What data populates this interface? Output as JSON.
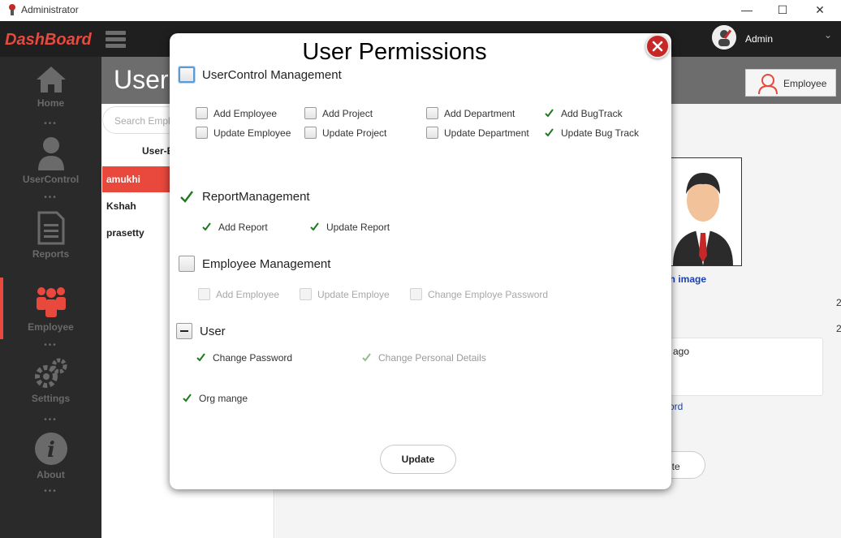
{
  "window": {
    "title": "Administrator",
    "minimize": "—",
    "maximize": "☐",
    "close": "✕"
  },
  "appbar": {
    "brand": "DashBoard",
    "user_name": "Admin",
    "caret": "⌄"
  },
  "sidebar": {
    "items": [
      {
        "label": "Home",
        "icon": "home-icon"
      },
      {
        "label": "UserControl",
        "icon": "user-icon"
      },
      {
        "label": "Reports",
        "icon": "document-icon"
      },
      {
        "label": "Employee",
        "icon": "group-icon",
        "active": true
      },
      {
        "label": "Settings",
        "icon": "gear-icon"
      },
      {
        "label": "About",
        "icon": "info-icon"
      }
    ],
    "dots": "•••"
  },
  "background": {
    "header_title": "User-",
    "employee_button": "Employee",
    "search_placeholder": "Search Empl",
    "column_header": "User-E",
    "users": [
      "amukhi",
      "Kshah",
      "prasetty"
    ],
    "photo_link": "ch image",
    "card_text": "ago",
    "password_link": "vord",
    "delete_button": "ete",
    "edge_marks": [
      "2",
      "2"
    ]
  },
  "modal": {
    "title": "User Permissions",
    "sections": {
      "user_control": {
        "label": "UserControl Management",
        "state": "unchecked-focused",
        "items": [
          {
            "label": "Add Employee",
            "state": "unchecked"
          },
          {
            "label": "Update Employee",
            "state": "unchecked"
          },
          {
            "label": "Add Project",
            "state": "unchecked"
          },
          {
            "label": "Update Project",
            "state": "unchecked"
          },
          {
            "label": "Add Department",
            "state": "unchecked"
          },
          {
            "label": "Update Department",
            "state": "unchecked"
          },
          {
            "label": "Add BugTrack",
            "state": "checked"
          },
          {
            "label": "Update Bug Track",
            "state": "checked"
          }
        ]
      },
      "report": {
        "label": "ReportManagement",
        "state": "checked",
        "items": [
          {
            "label": "Add Report",
            "state": "checked"
          },
          {
            "label": "Update Report",
            "state": "checked"
          }
        ]
      },
      "employee": {
        "label": "Employee Management",
        "state": "unchecked",
        "items": [
          {
            "label": "Add Employee",
            "state": "disabled"
          },
          {
            "label": "Update Employe",
            "state": "disabled"
          },
          {
            "label": "Change Employe Password",
            "state": "disabled"
          }
        ]
      },
      "user": {
        "label": "User",
        "state": "indeterminate",
        "items": [
          {
            "label": "Change Password",
            "state": "checked"
          },
          {
            "label": "Change Personal Details",
            "state": "checked-faded"
          }
        ]
      },
      "org": {
        "label": "Org mange",
        "state": "checked"
      }
    },
    "update_button": "Update"
  },
  "colors": {
    "accent": "#e9483d",
    "check": "#1f7a1f",
    "sidebar": "#2a2a2a"
  }
}
